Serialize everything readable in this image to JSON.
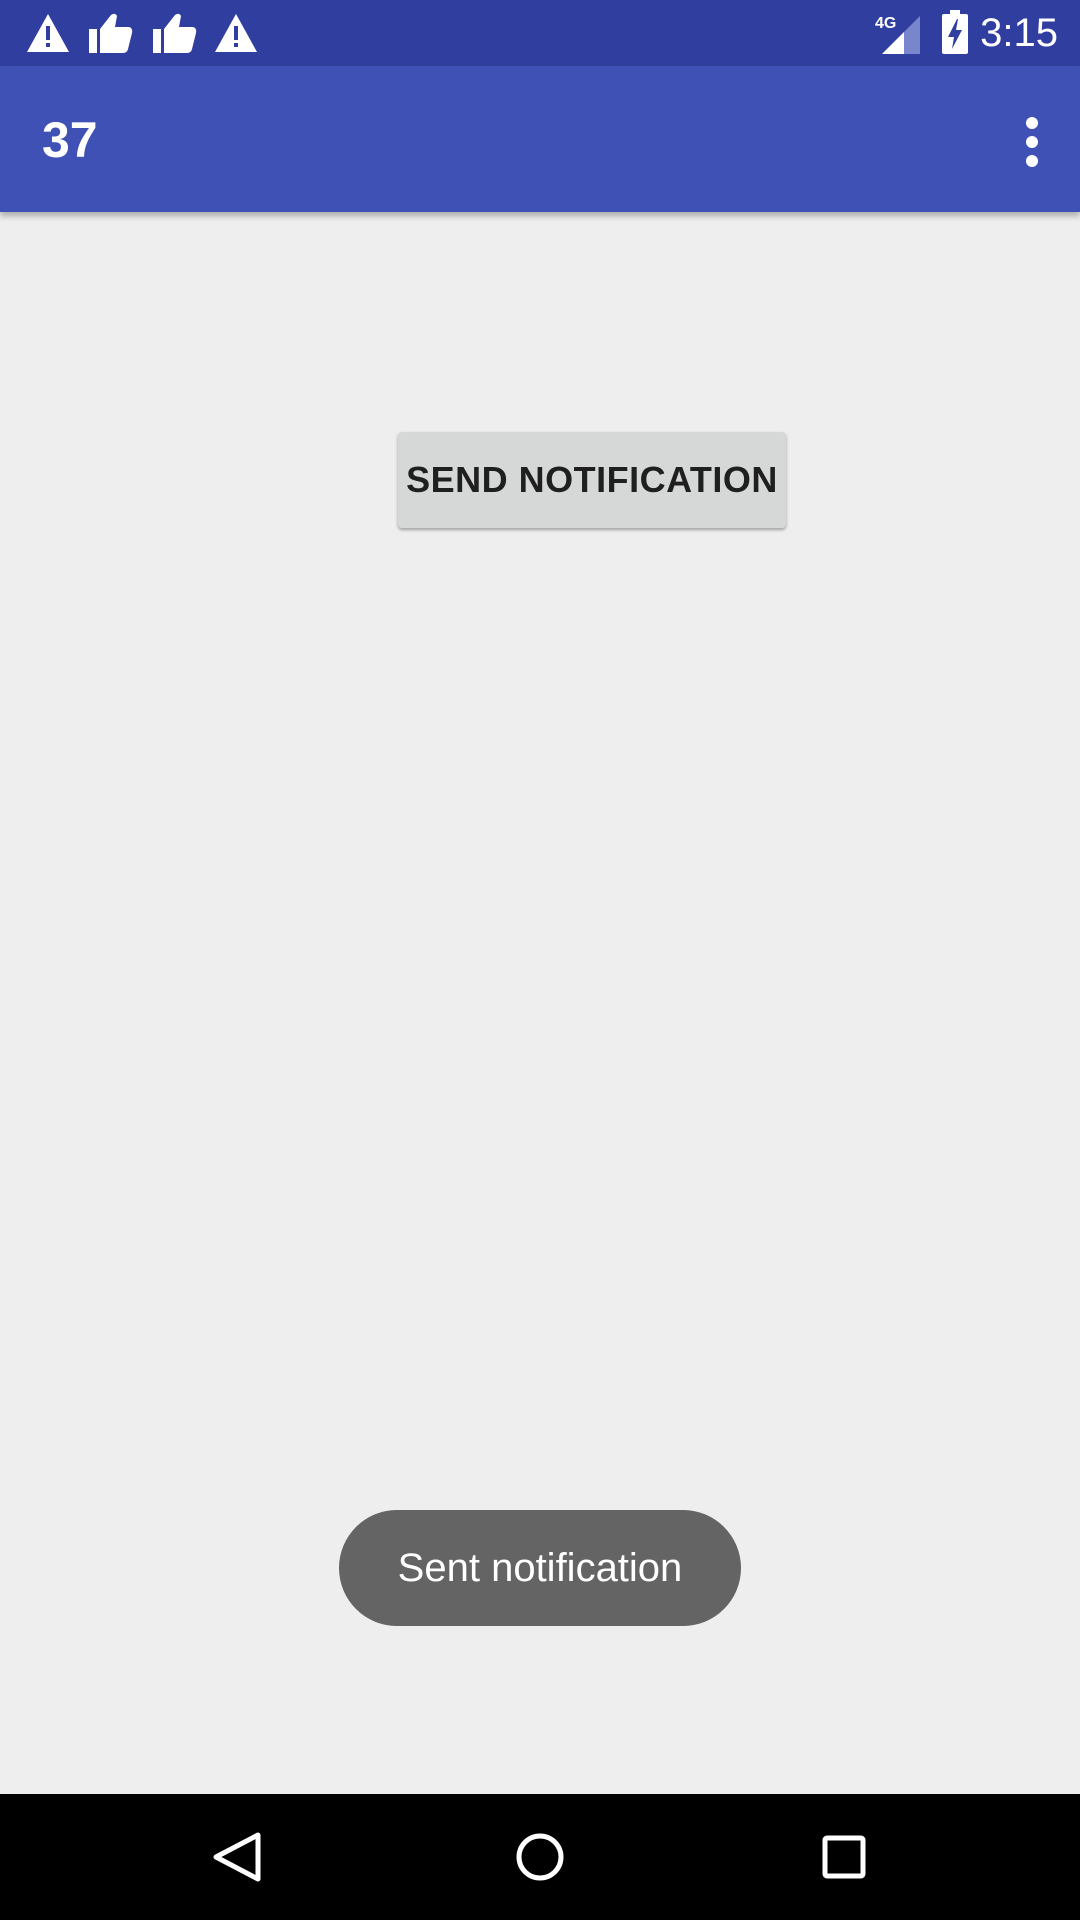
{
  "status_bar": {
    "notification_icons": [
      "warning-icon",
      "thumbs-up-icon",
      "thumbs-up-icon",
      "warning-icon"
    ],
    "network_label": "4G",
    "time": "3:15",
    "background_color": "#303F9F"
  },
  "app_bar": {
    "title": "37",
    "overflow_icon": "more-vert-icon",
    "background_color": "#3F51B5"
  },
  "main": {
    "send_button_label": "SEND NOTIFICATION",
    "background_color": "#EEEEEE"
  },
  "toast": {
    "message": "Sent notification"
  },
  "nav_bar": {
    "buttons": [
      "back-icon",
      "home-icon",
      "recents-icon"
    ]
  }
}
